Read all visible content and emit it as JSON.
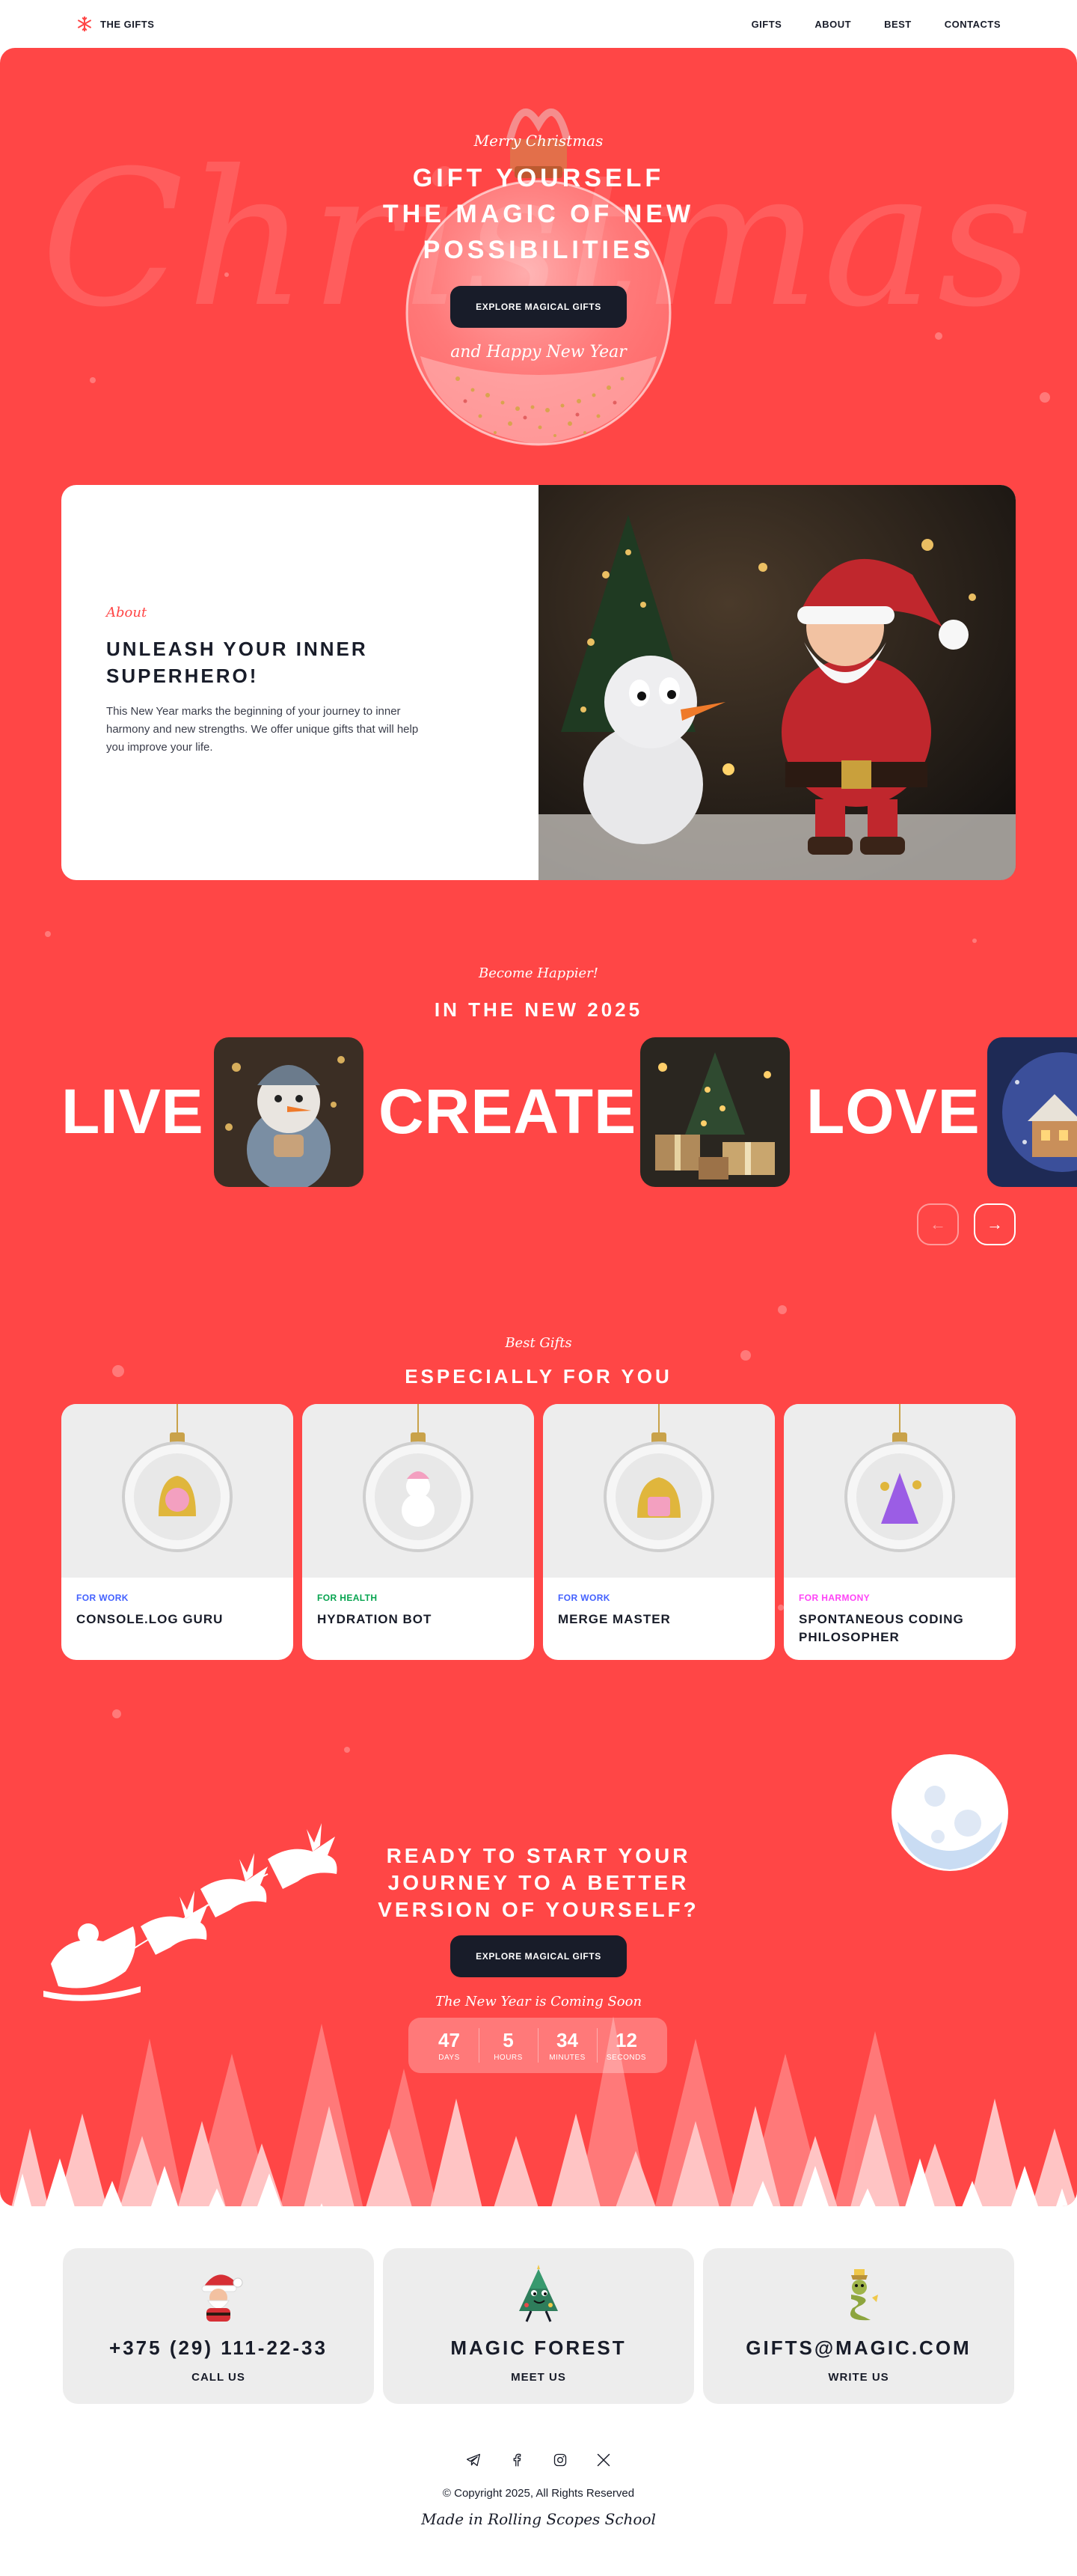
{
  "header": {
    "logo_text": "THE GIFTS",
    "nav": [
      "GIFTS",
      "ABOUT",
      "BEST",
      "CONTACTS"
    ]
  },
  "hero": {
    "background_word": "Christmas",
    "script_top": "Merry Christmas",
    "title_lines": [
      "GIFT YOURSELF",
      "THE MAGIC OF NEW",
      "POSSIBILITIES"
    ],
    "button": "EXPLORE MAGICAL GIFTS",
    "script_bottom": "and Happy New Year"
  },
  "about": {
    "script": "About",
    "title_lines": [
      "UNLEASH YOUR INNER",
      "SUPERHERO!"
    ],
    "description": "This New Year marks the beginning of your journey to inner harmony and new strengths. We offer unique gifts that will help you improve your life."
  },
  "slider": {
    "script": "Become Happier!",
    "title": "IN THE NEW 2025",
    "words": [
      "LIVE",
      "CREATE",
      "LOVE"
    ],
    "prev_icon": "arrow-left-icon",
    "next_icon": "arrow-right-icon"
  },
  "gifts": {
    "script": "Best Gifts",
    "title": "ESPECIALLY FOR YOU",
    "items": [
      {
        "category": "FOR WORK",
        "name": "CONSOLE.LOG GURU",
        "color": "#4361FF"
      },
      {
        "category": "FOR HEALTH",
        "name": "HYDRATION BOT",
        "color": "#06A44F"
      },
      {
        "category": "FOR WORK",
        "name": "MERGE MASTER",
        "color": "#4361FF"
      },
      {
        "category": "FOR HARMONY",
        "name": "SPONTANEOUS CODING PHILOSOPHER",
        "color": "#FF43F7"
      }
    ]
  },
  "cta": {
    "title_lines": [
      "READY TO START YOUR",
      "JOURNEY TO A BETTER",
      "VERSION OF YOURSELF?"
    ],
    "button": "EXPLORE MAGICAL GIFTS",
    "script": "The New Year is Coming Soon",
    "countdown": [
      {
        "value": "47",
        "label": "DAYS"
      },
      {
        "value": "5",
        "label": "HOURS"
      },
      {
        "value": "34",
        "label": "MINUTES"
      },
      {
        "value": "12",
        "label": "SECONDS"
      }
    ]
  },
  "contacts": [
    {
      "value": "+375 (29) 111-22-33",
      "label": "CALL US",
      "icon": "santa-icon"
    },
    {
      "value": "MAGIC FOREST",
      "label": "MEET US",
      "icon": "christmas-tree-icon"
    },
    {
      "value": "GIFTS@MAGIC.COM",
      "label": "WRITE US",
      "icon": "snake-icon"
    }
  ],
  "footer": {
    "socials": [
      "telegram-icon",
      "facebook-icon",
      "instagram-icon",
      "x-icon"
    ],
    "copyright": "© Copyright 2025, All Rights Reserved",
    "made_in": "Made in Rolling Scopes School"
  },
  "colors": {
    "primary_red": "#FF4646",
    "dark": "#181C29",
    "card_gray": "#EDEDED"
  }
}
